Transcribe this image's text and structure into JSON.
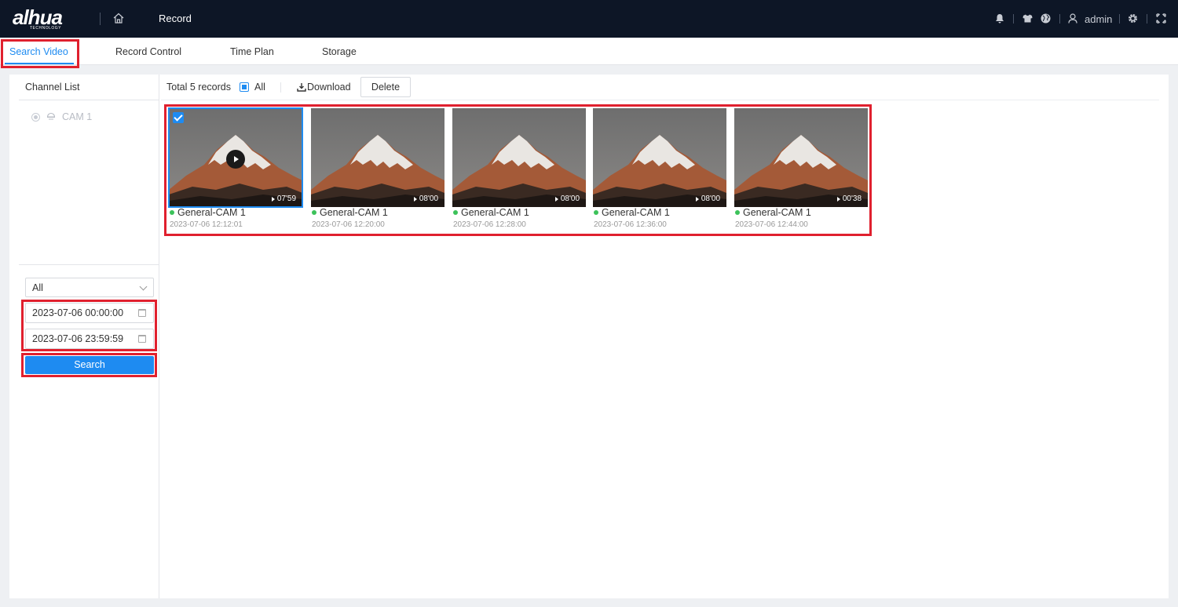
{
  "header": {
    "logo_text": "alhua",
    "logo_subtext": "TECHNOLOGY",
    "breadcrumb": "Record",
    "user": "admin",
    "icons": [
      "bell-icon",
      "shirt-icon",
      "globe-icon",
      "user-icon",
      "gear-icon",
      "fullscreen-icon"
    ]
  },
  "tabs": [
    {
      "label": "Search Video",
      "active": true
    },
    {
      "label": "Record Control",
      "active": false
    },
    {
      "label": "Time Plan",
      "active": false
    },
    {
      "label": "Storage",
      "active": false
    }
  ],
  "sidebar": {
    "channel_list_label": "Channel List",
    "channels": [
      {
        "label": "CAM 1"
      }
    ],
    "record_type": "All",
    "start_time": "2023-07-06 00:00:00",
    "end_time": "2023-07-06 23:59:59",
    "search_label": "Search"
  },
  "toolbar": {
    "total_label": "Total 5 records",
    "all_label": "All",
    "download_label": "Download",
    "delete_label": "Delete"
  },
  "records": [
    {
      "name": "General-CAM 1",
      "time": "2023-07-06 12:12:01",
      "duration": "07'59",
      "selected": true
    },
    {
      "name": "General-CAM 1",
      "time": "2023-07-06 12:20:00",
      "duration": "08'00",
      "selected": false
    },
    {
      "name": "General-CAM 1",
      "time": "2023-07-06 12:28:00",
      "duration": "08'00",
      "selected": false
    },
    {
      "name": "General-CAM 1",
      "time": "2023-07-06 12:36:00",
      "duration": "08'00",
      "selected": false
    },
    {
      "name": "General-CAM 1",
      "time": "2023-07-06 12:44:00",
      "duration": "00'38",
      "selected": false
    }
  ],
  "colors": {
    "accent": "#1e8bf1",
    "topbar": "#0d1626",
    "highlight": "#e0202e",
    "status_dot": "#3cc25a"
  }
}
